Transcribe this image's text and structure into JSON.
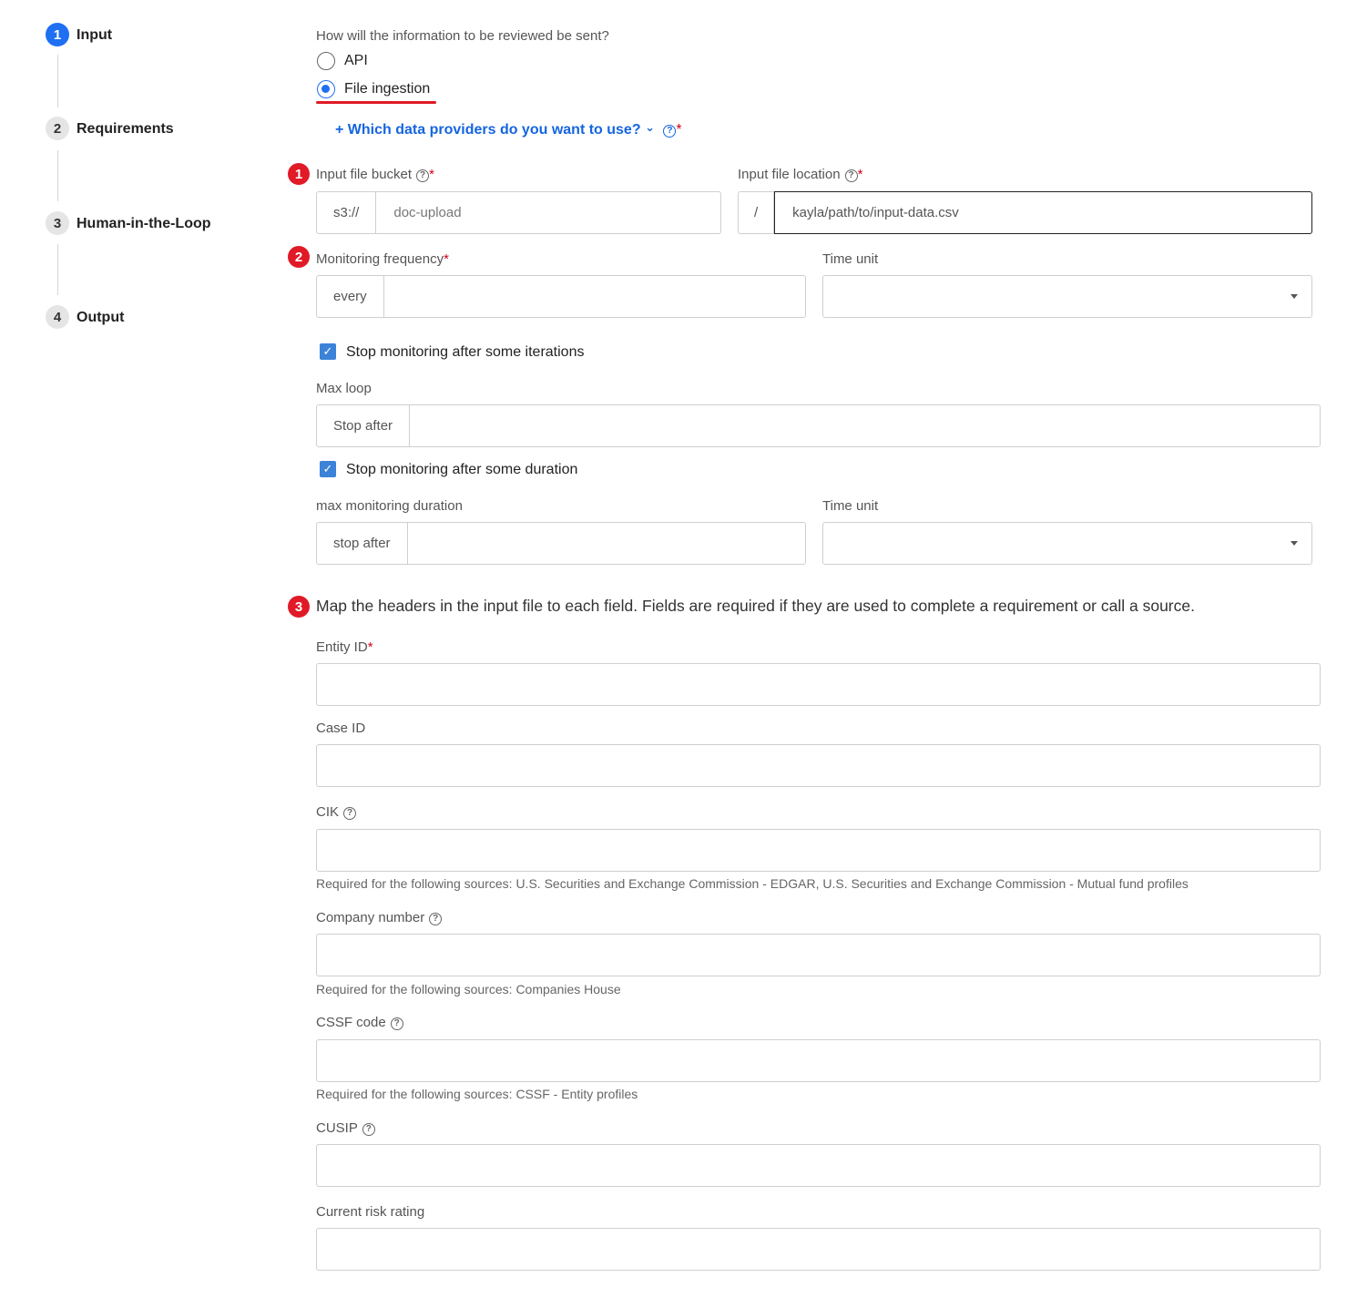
{
  "stepper": {
    "steps": [
      {
        "number": "1",
        "label": "Input",
        "state": "active"
      },
      {
        "number": "2",
        "label": "Requirements",
        "state": "inactive"
      },
      {
        "number": "3",
        "label": "Human-in-the-Loop",
        "state": "inactive"
      },
      {
        "number": "4",
        "label": "Output",
        "state": "inactive"
      }
    ]
  },
  "delivery": {
    "question": "How will the information to be reviewed be sent?",
    "options": [
      "API",
      "File ingestion"
    ],
    "selected": "File ingestion"
  },
  "providers_link": {
    "plus": "+",
    "text": "Which data providers do you want to use?",
    "required_mark": "*"
  },
  "annotations": [
    "1",
    "2",
    "3"
  ],
  "input_bucket": {
    "label": "Input file bucket",
    "required_mark": "*",
    "prefix": "s3://",
    "value": "doc-upload"
  },
  "input_location": {
    "label": "Input file location",
    "required_mark": "*",
    "prefix": "/",
    "value": "kayla/path/to/input-data.csv"
  },
  "monitoring": {
    "label": "Monitoring frequency",
    "required_mark": "*",
    "prefix": "every",
    "value": "",
    "time_unit_label": "Time unit",
    "time_unit_value": ""
  },
  "stop_iterations": {
    "checkbox_label": "Stop monitoring after some iterations",
    "checked": true,
    "field_label": "Max loop",
    "prefix": "Stop after",
    "value": ""
  },
  "stop_duration": {
    "checkbox_label": "Stop monitoring after some duration",
    "checked": true,
    "field_label": "max monitoring duration",
    "prefix": "stop after",
    "value": "",
    "time_unit_label": "Time unit",
    "time_unit_value": ""
  },
  "mapping": {
    "heading": "Map the headers in the input file to each field. Fields are required if they are used to complete a requirement or call a source.",
    "fields": [
      {
        "label": "Entity ID",
        "required_mark": "*",
        "hint": ""
      },
      {
        "label": "Case ID",
        "required_mark": "",
        "hint": ""
      },
      {
        "label": "CIK",
        "required_mark": "",
        "hint": "Required for the following sources: U.S. Securities and Exchange Commission - EDGAR, U.S. Securities and Exchange Commission - Mutual fund profiles"
      },
      {
        "label": "Company number",
        "required_mark": "",
        "hint": "Required for the following sources: Companies House"
      },
      {
        "label": "CSSF code",
        "required_mark": "",
        "hint": "Required for the following sources: CSSF - Entity profiles"
      },
      {
        "label": "CUSIP",
        "required_mark": "",
        "hint": ""
      },
      {
        "label": "Current risk rating",
        "required_mark": "",
        "hint": ""
      }
    ]
  },
  "icons": {
    "help": "?",
    "chevron": "⌄",
    "check": "✓"
  },
  "colors": {
    "primary": "#1f6ff2",
    "link": "#1565e0",
    "annotation": "#e01a26",
    "required": "#d0021b"
  }
}
